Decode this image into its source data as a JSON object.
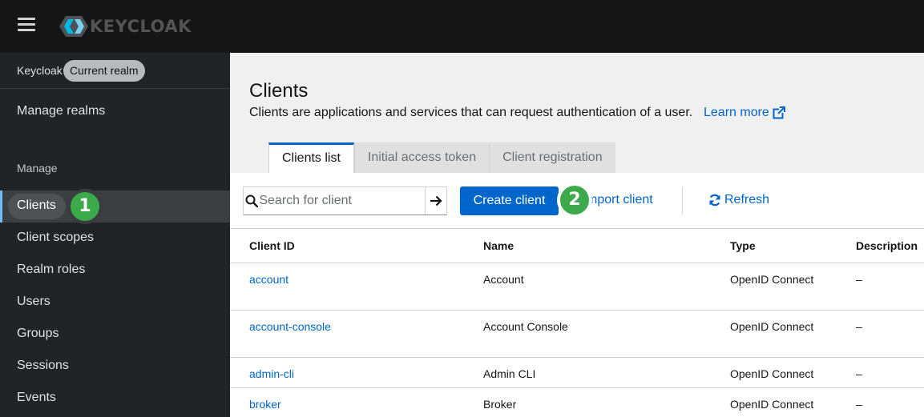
{
  "header": {
    "logo_text": "KEYCLOAK"
  },
  "sidebar": {
    "realm_name": "Keycloak",
    "realm_badge": "Current realm",
    "manage_realms": "Manage realms",
    "section_label": "Manage",
    "items": [
      {
        "label": "Clients"
      },
      {
        "label": "Client scopes"
      },
      {
        "label": "Realm roles"
      },
      {
        "label": "Users"
      },
      {
        "label": "Groups"
      },
      {
        "label": "Sessions"
      },
      {
        "label": "Events"
      }
    ]
  },
  "steps": {
    "one": "1",
    "two": "2"
  },
  "page": {
    "title": "Clients",
    "description": "Clients are applications and services that can request authentication of a user.",
    "learn_more": "Learn more",
    "tabs": [
      {
        "label": "Clients list"
      },
      {
        "label": "Initial access token"
      },
      {
        "label": "Client registration"
      }
    ]
  },
  "toolbar": {
    "search_placeholder": "Search for client",
    "create_label": "Create client",
    "import_label": "mport client",
    "refresh_label": "Refresh"
  },
  "table": {
    "headers": [
      "Client ID",
      "Name",
      "Type",
      "Description"
    ],
    "rows": [
      {
        "client_id": "account",
        "name": "Account",
        "type": "OpenID Connect",
        "description": "–"
      },
      {
        "client_id": "account-console",
        "name": "Account Console",
        "type": "OpenID Connect",
        "description": "–"
      },
      {
        "client_id": "admin-cli",
        "name": "Admin CLI",
        "type": "OpenID Connect",
        "description": "–"
      },
      {
        "client_id": "broker",
        "name": "Broker",
        "type": "OpenID Connect",
        "description": "–"
      }
    ]
  },
  "colors": {
    "accent": "#0066cc",
    "sidebar_bg": "#212427",
    "step_green": "#3ca94b"
  }
}
